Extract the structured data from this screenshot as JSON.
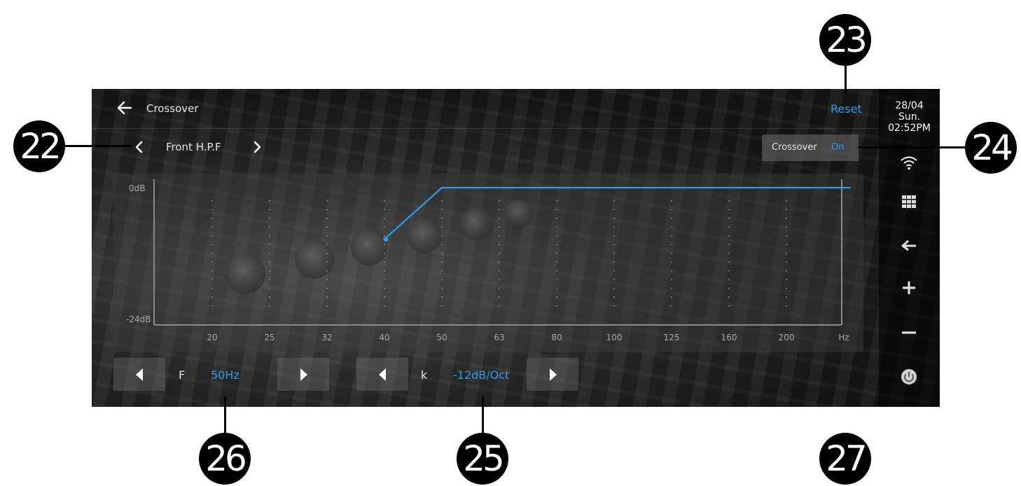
{
  "header": {
    "title": "Crossover",
    "reset_label": "Reset"
  },
  "status": {
    "date": "28/04",
    "day": "Sun.",
    "time": "02:52PM"
  },
  "selector": {
    "channel": "Front H.P.F"
  },
  "crossover_toggle": {
    "label": "Crossover",
    "value": "On"
  },
  "controls": {
    "freq_label": "F",
    "freq_value": "50Hz",
    "slope_label": "k",
    "slope_value": "-12dB/Oct"
  },
  "sidebar_icons": [
    "wifi-icon",
    "apps-grid-icon",
    "back-arrow-icon",
    "volume-up-icon",
    "volume-down-icon",
    "power-icon"
  ],
  "callouts": [
    "22",
    "23",
    "24",
    "25",
    "26",
    "27"
  ],
  "accent_color": "#2f9be6",
  "chart_data": {
    "type": "line",
    "x_unit": "Hz",
    "categories": [
      "20",
      "25",
      "32",
      "40",
      "50",
      "63",
      "80",
      "100",
      "125",
      "160",
      "200",
      "Hz"
    ],
    "y_labels": [
      "0dB",
      "-24dB"
    ],
    "ylim": [
      -24,
      0
    ],
    "crossover_point": {
      "x": "40",
      "y_db": -9
    },
    "series": [
      {
        "points": [
          {
            "x": "40",
            "y": -9
          },
          {
            "x": "50",
            "y": 0
          },
          {
            "x": "Hz",
            "y": 0
          }
        ]
      }
    ]
  }
}
